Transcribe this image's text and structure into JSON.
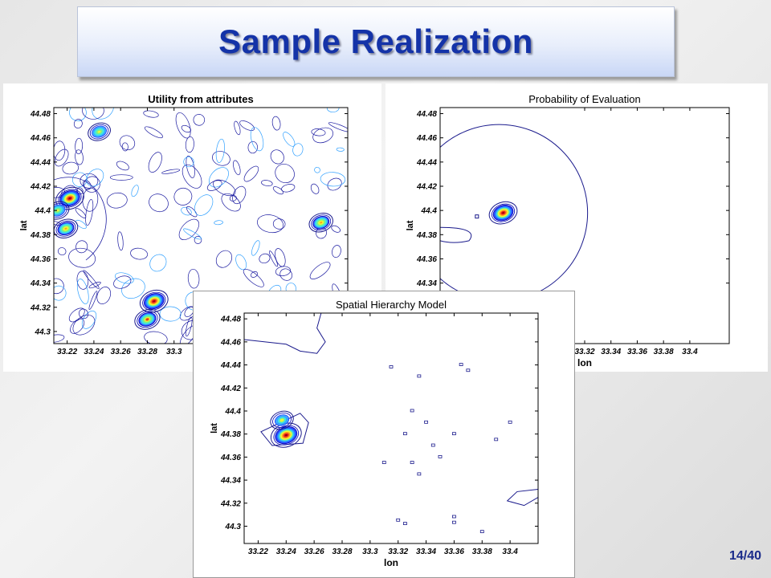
{
  "slide": {
    "title": "Sample Realization",
    "page_number": "14/40"
  },
  "chart_data": [
    {
      "type": "heatmap",
      "title": "Utility from attributes",
      "xlabel": "",
      "ylabel": "lat",
      "x_ticks": [
        "33.22",
        "33.24",
        "33.26",
        "33.28",
        "33.3"
      ],
      "y_ticks": [
        "44.48",
        "44.46",
        "44.44",
        "44.42",
        "44.4",
        "44.38",
        "44.36",
        "44.34",
        "44.32",
        "44.3"
      ],
      "xlim": [
        33.21,
        33.43
      ],
      "ylim": [
        44.29,
        44.485
      ],
      "hotspots": [
        {
          "x": 33.222,
          "y": 44.41,
          "peak": 1.0
        },
        {
          "x": 33.219,
          "y": 44.385,
          "peak": 0.7
        },
        {
          "x": 33.213,
          "y": 44.4,
          "peak": 0.6
        },
        {
          "x": 33.244,
          "y": 44.465,
          "peak": 0.6
        },
        {
          "x": 33.285,
          "y": 44.325,
          "peak": 1.0
        },
        {
          "x": 33.28,
          "y": 44.31,
          "peak": 0.8
        },
        {
          "x": 33.41,
          "y": 44.39,
          "peak": 0.7
        }
      ]
    },
    {
      "type": "heatmap",
      "title": "Probability of Evaluation",
      "xlabel": "lon",
      "ylabel": "lat",
      "x_ticks": [
        "33.32",
        "33.34",
        "33.36",
        "33.38",
        "33.4"
      ],
      "y_ticks": [
        "44.48",
        "44.46",
        "44.44",
        "44.42",
        "44.4",
        "44.38",
        "44.36",
        "44.34"
      ],
      "xlim": [
        33.21,
        33.43
      ],
      "ylim": [
        44.29,
        44.485
      ],
      "hotspots": [
        {
          "x": 33.258,
          "y": 44.398,
          "peak": 1.0
        }
      ]
    },
    {
      "type": "heatmap",
      "title": "Spatial Hierarchy Model",
      "xlabel": "lon",
      "ylabel": "lat",
      "x_ticks": [
        "33.22",
        "33.24",
        "33.26",
        "33.28",
        "33.3",
        "33.32",
        "33.34",
        "33.36",
        "33.38",
        "33.4"
      ],
      "y_ticks": [
        "44.48",
        "44.46",
        "44.44",
        "44.42",
        "44.4",
        "44.38",
        "44.36",
        "44.34",
        "44.32",
        "44.3"
      ],
      "xlim": [
        33.21,
        33.42
      ],
      "ylim": [
        44.285,
        44.485
      ],
      "hotspots": [
        {
          "x": 33.24,
          "y": 44.379,
          "peak": 1.0
        },
        {
          "x": 33.237,
          "y": 44.392,
          "peak": 0.5
        }
      ]
    }
  ]
}
